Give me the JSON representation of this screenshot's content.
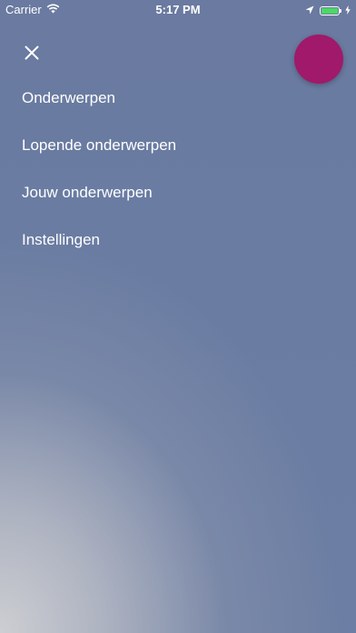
{
  "status_bar": {
    "carrier": "Carrier",
    "time": "5:17 PM",
    "battery_level": 1.0,
    "battery_color": "#4cd964",
    "icons": [
      "wifi-icon",
      "location-arrow-icon",
      "battery-icon",
      "charging-bolt-icon"
    ]
  },
  "header": {
    "close_icon": "close-icon",
    "fab_color": "#a0196a"
  },
  "menu": {
    "items": [
      {
        "label": "Onderwerpen"
      },
      {
        "label": "Lopende onderwerpen"
      },
      {
        "label": "Jouw onderwerpen"
      },
      {
        "label": "Instellingen"
      }
    ]
  }
}
